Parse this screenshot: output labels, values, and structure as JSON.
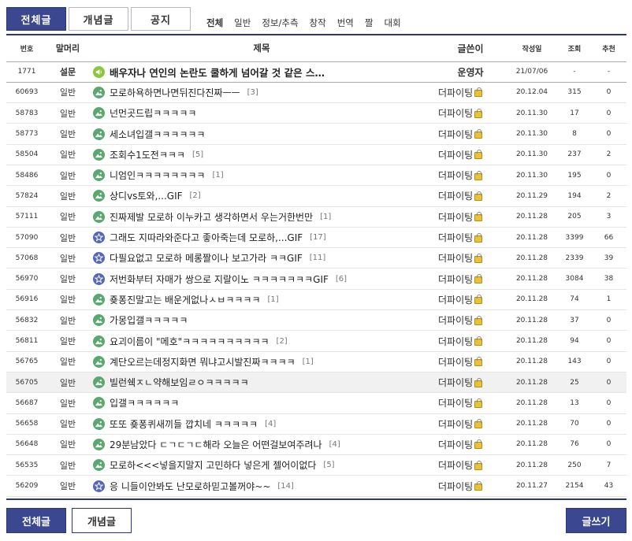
{
  "top_tabs": [
    {
      "label": "전체글",
      "active": true
    },
    {
      "label": "개념글",
      "active": false
    },
    {
      "label": "공지",
      "active": false
    }
  ],
  "sub_categories": [
    {
      "label": "전체",
      "current": true
    },
    {
      "label": "일반",
      "current": false
    },
    {
      "label": "정보/추측",
      "current": false
    },
    {
      "label": "창작",
      "current": false
    },
    {
      "label": "번역",
      "current": false
    },
    {
      "label": "짤",
      "current": false
    },
    {
      "label": "대회",
      "current": false
    }
  ],
  "columns": {
    "num": "번호",
    "head": "말머리",
    "title": "제목",
    "writer": "글쓴이",
    "date": "작성일",
    "views": "조회",
    "recommend": "추천"
  },
  "posts": [
    {
      "num": "1771",
      "head": "설문",
      "icon": "speaker",
      "title": "배우자나 연인의 논란도 쿨하게 넘어갈 것 같은 스…",
      "comments": "",
      "writer": "운영자",
      "lock": false,
      "date": "21/07/06",
      "views": "-",
      "recommend": "-",
      "notice": true
    },
    {
      "num": "60693",
      "head": "일반",
      "icon": "picture",
      "title": "모로하욕하면나면뒤진다진짜ㅡㅡ",
      "comments": "[3]",
      "writer": "더파이팅",
      "lock": true,
      "date": "20.12.04",
      "views": "315",
      "recommend": "0"
    },
    {
      "num": "58783",
      "head": "일반",
      "icon": "picture",
      "title": "넌먼곳드립ㅋㅋㅋㅋㅋ",
      "comments": "",
      "writer": "더파이팅",
      "lock": true,
      "date": "20.11.30",
      "views": "17",
      "recommend": "0"
    },
    {
      "num": "58773",
      "head": "일반",
      "icon": "picture",
      "title": "세소녀입갤ㅋㅋㅋㅋㅋㅋ",
      "comments": "",
      "writer": "더파이팅",
      "lock": true,
      "date": "20.11.30",
      "views": "8",
      "recommend": "0"
    },
    {
      "num": "58504",
      "head": "일반",
      "icon": "picture",
      "title": "조회수1도전ㅋㅋㅋ",
      "comments": "[5]",
      "writer": "더파이팅",
      "lock": true,
      "date": "20.11.30",
      "views": "237",
      "recommend": "2"
    },
    {
      "num": "58486",
      "head": "일반",
      "icon": "picture",
      "title": "니엄인ㅋㅋㅋㅋㅋㅋㅋㅋ",
      "comments": "[1]",
      "writer": "더파이팅",
      "lock": true,
      "date": "20.11.30",
      "views": "195",
      "recommend": "0"
    },
    {
      "num": "57824",
      "head": "일반",
      "icon": "picture",
      "title": "상디vs토와,...GIF",
      "comments": "[2]",
      "writer": "더파이팅",
      "lock": true,
      "date": "20.11.29",
      "views": "194",
      "recommend": "2"
    },
    {
      "num": "57111",
      "head": "일반",
      "icon": "picture",
      "title": "진짜제발 모로하 이누카고 생각하면서 우는거한번만",
      "comments": "[1]",
      "writer": "더파이팅",
      "lock": true,
      "date": "20.11.28",
      "views": "205",
      "recommend": "3"
    },
    {
      "num": "57090",
      "head": "일반",
      "icon": "star",
      "title": "그래도 지따라와준다고 좋아죽는데 모로하,...GIF",
      "comments": "[17]",
      "writer": "더파이팅",
      "lock": true,
      "date": "20.11.28",
      "views": "3399",
      "recommend": "66"
    },
    {
      "num": "57068",
      "head": "일반",
      "icon": "star",
      "title": "다필요없고 모로하 메롱짤이나 보고가라 ㅋㅋGIF",
      "comments": "[11]",
      "writer": "더파이팅",
      "lock": true,
      "date": "20.11.28",
      "views": "2339",
      "recommend": "39"
    },
    {
      "num": "56970",
      "head": "일반",
      "icon": "star",
      "title": "저번화부터 자매가 쌍으로 지랄이노 ㅋㅋㅋㅋㅋㅋㅋGIF",
      "comments": "[6]",
      "writer": "더파이팅",
      "lock": true,
      "date": "20.11.28",
      "views": "3084",
      "recommend": "38"
    },
    {
      "num": "56916",
      "head": "일반",
      "icon": "picture",
      "title": "죶퐁진말고는 배운게없나ㅅㅂㅋㅋㅋㅋ",
      "comments": "[1]",
      "writer": "더파이팅",
      "lock": true,
      "date": "20.11.28",
      "views": "74",
      "recommend": "1"
    },
    {
      "num": "56832",
      "head": "일반",
      "icon": "picture",
      "title": "가몽입갤ㅋㅋㅋㅋㅋ",
      "comments": "",
      "writer": "더파이팅",
      "lock": true,
      "date": "20.11.28",
      "views": "37",
      "recommend": "0"
    },
    {
      "num": "56811",
      "head": "일반",
      "icon": "picture",
      "title": "요괴이름이 \"메호\"ㅋㅋㅋㅋㅋㅋㅋㅋㅋㅋ",
      "comments": "[2]",
      "writer": "더파이팅",
      "lock": true,
      "date": "20.11.28",
      "views": "94",
      "recommend": "0"
    },
    {
      "num": "56765",
      "head": "일반",
      "icon": "picture",
      "title": "계단오르는데정지화면 뭐냐고시발진짜ㅋㅋㅋㅋ",
      "comments": "[1]",
      "writer": "더파이팅",
      "lock": true,
      "date": "20.11.28",
      "views": "143",
      "recommend": "0"
    },
    {
      "num": "56705",
      "head": "일반",
      "icon": "picture",
      "title": "빌런쉑ㅈㄴ약해보임ㄹㅇㅋㅋㅋㅋㅋ",
      "comments": "",
      "writer": "더파이팅",
      "lock": true,
      "date": "20.11.28",
      "views": "25",
      "recommend": "0",
      "highlight": true
    },
    {
      "num": "56687",
      "head": "일반",
      "icon": "picture",
      "title": "입갤ㅋㅋㅋㅋㅋㅋ",
      "comments": "",
      "writer": "더파이팅",
      "lock": true,
      "date": "20.11.28",
      "views": "13",
      "recommend": "0"
    },
    {
      "num": "56658",
      "head": "일반",
      "icon": "picture",
      "title": "또또 죶퐁퀴새끼들 깝치네 ㅋㅋㅋㅋㅋ",
      "comments": "[4]",
      "writer": "더파이팅",
      "lock": true,
      "date": "20.11.28",
      "views": "70",
      "recommend": "0"
    },
    {
      "num": "56648",
      "head": "일반",
      "icon": "picture",
      "title": "29분남았다 ㄷㄱㄷㄱㄷ해라 오늘은 어떤걸보여주려나",
      "comments": "[4]",
      "writer": "더파이팅",
      "lock": true,
      "date": "20.11.28",
      "views": "76",
      "recommend": "0"
    },
    {
      "num": "56535",
      "head": "일반",
      "icon": "picture",
      "title": "모로하<<<넣을지말지 고민하다 넣은게 젤어이없다",
      "comments": "[5]",
      "writer": "더파이팅",
      "lock": true,
      "date": "20.11.28",
      "views": "250",
      "recommend": "7"
    },
    {
      "num": "56209",
      "head": "일반",
      "icon": "star",
      "title": "응 니들이안봐도 난모로하믿고볼꺼야~~",
      "comments": "[14]",
      "writer": "더파이팅",
      "lock": true,
      "date": "20.11.27",
      "views": "2154",
      "recommend": "43"
    }
  ],
  "bottom_tabs": [
    {
      "label": "전체글",
      "active": true
    },
    {
      "label": "개념글",
      "active": false
    }
  ],
  "write_button": "글쓰기",
  "colors": {
    "primary": "#3b4890",
    "border": "#29367c",
    "pic_icon": "#5aa870",
    "star_icon": "#5567b8",
    "speaker_icon": "#8cc63f"
  }
}
